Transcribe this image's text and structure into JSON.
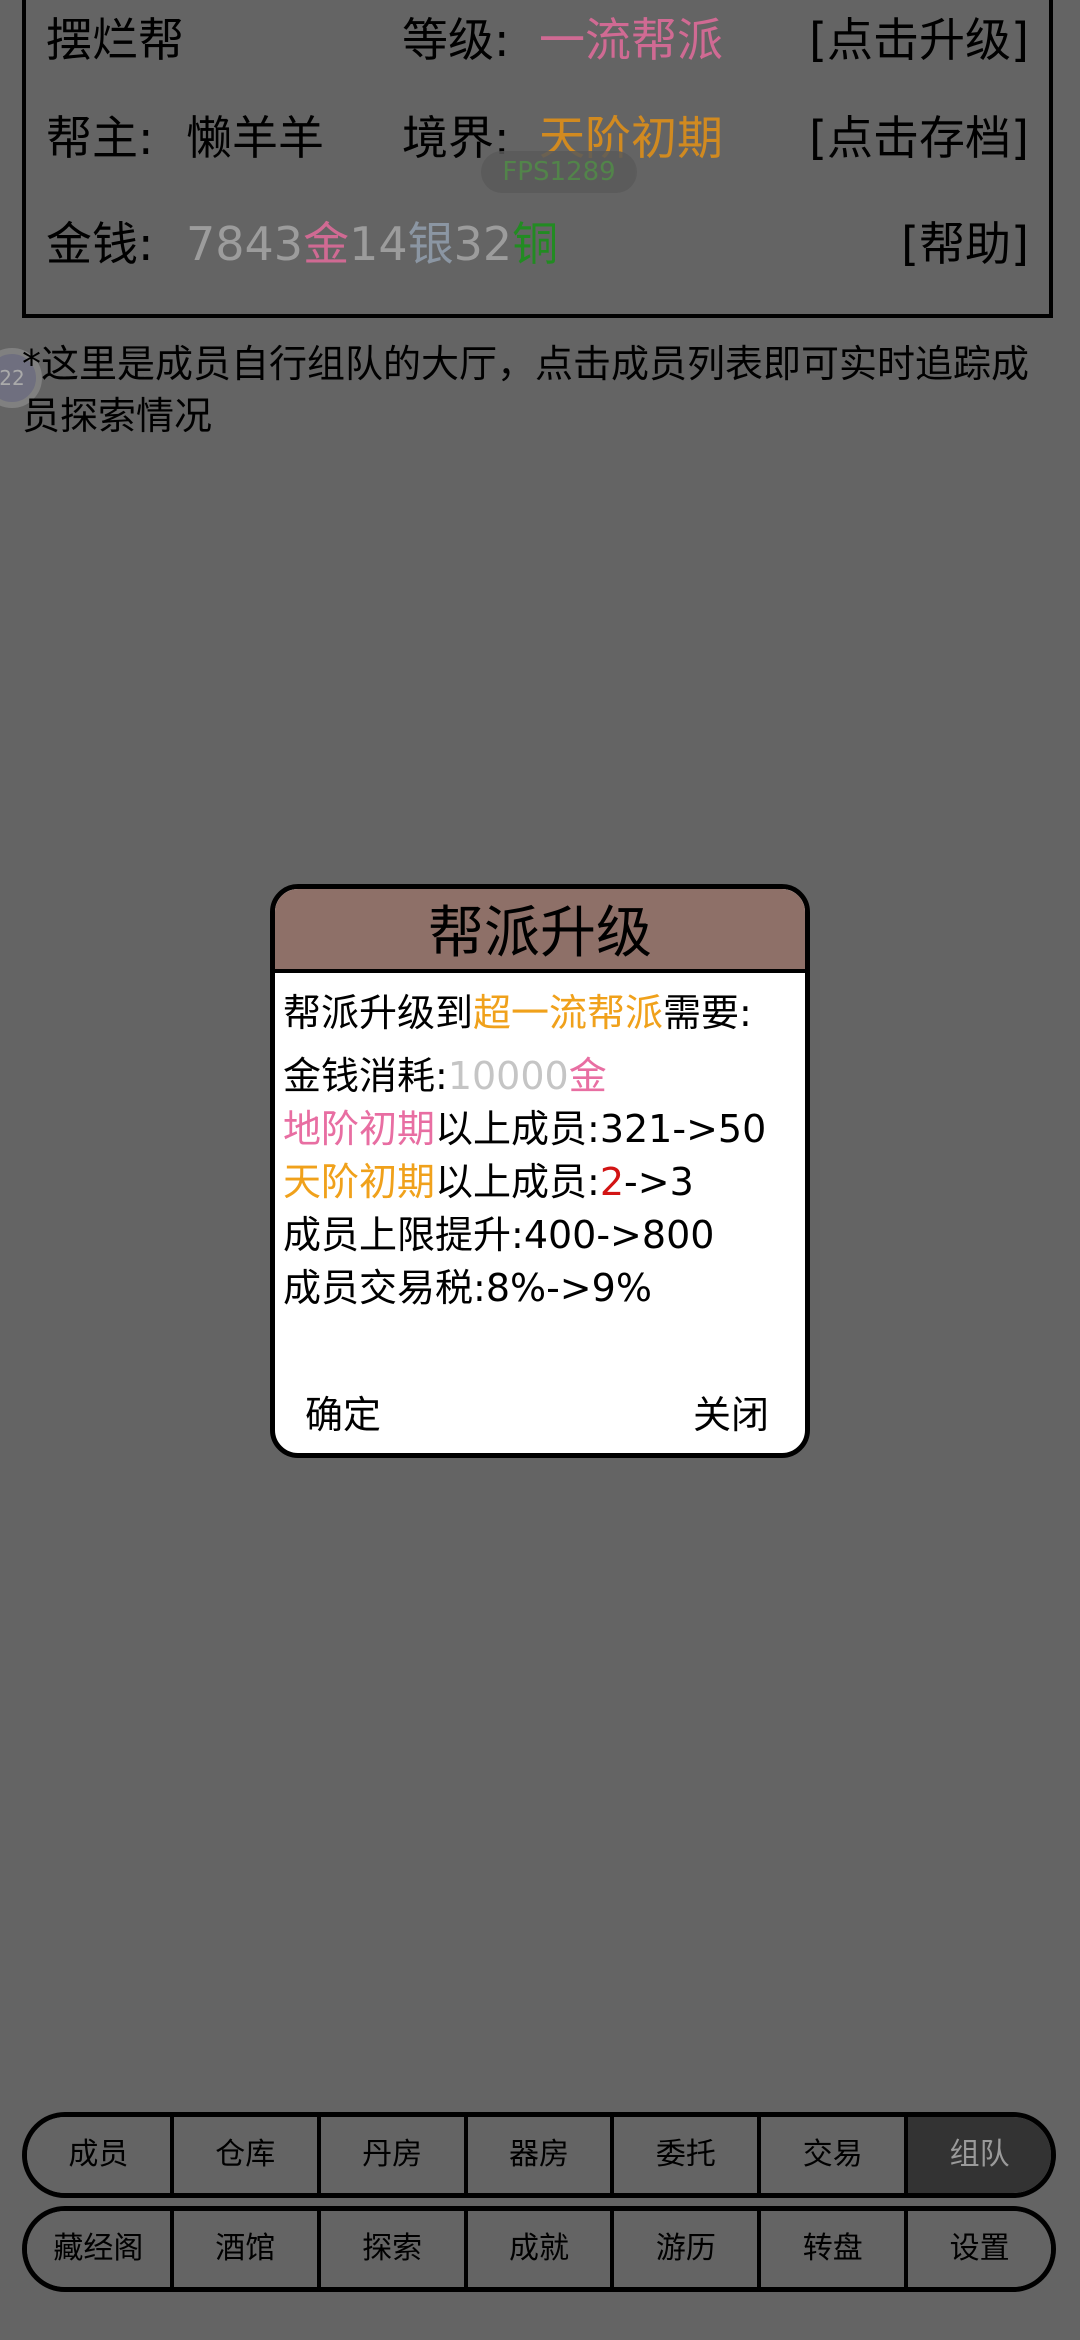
{
  "header": {
    "sect_name": "摆烂帮",
    "level_label": "等级:",
    "level_value": "一流帮派",
    "upgrade_button": "[点击升级]",
    "leader_label": "帮主:",
    "leader_name": "懒羊羊",
    "realm_label": "境界:",
    "realm_value": "天阶初期",
    "save_button": "[点击存档]",
    "money_label": "金钱:",
    "money": {
      "gold": "7843",
      "gold_unit": "金",
      "silver": "14",
      "silver_unit": "银",
      "copper": "32",
      "copper_unit": "铜"
    },
    "help_button": "[帮助]",
    "fps": "FPS1289"
  },
  "notice": "*这里是成员自行组队的大厅，点击成员列表即可实时追踪成员探索情况",
  "float_ball_text": "22",
  "dialog": {
    "title": "帮派升级",
    "line1_prefix": "帮派升级到",
    "target_level": "超一流帮派",
    "line1_suffix": "需要:",
    "cost_label": "金钱消耗:",
    "cost_value": "10000",
    "cost_unit": "金",
    "req1_realm": "地阶初期",
    "req1_text": "以上成员:",
    "req1_value": "321->50",
    "req2_realm": "天阶初期",
    "req2_text": "以上成员:",
    "req2_current": "2",
    "req2_target": "->3",
    "limit_text": "成员上限提升:",
    "limit_value": "400->800",
    "tax_text": "成员交易税:",
    "tax_value": "8%->9%",
    "confirm": "确定",
    "close": "关闭"
  },
  "tabs_row1": [
    "成员",
    "仓库",
    "丹房",
    "器房",
    "委托",
    "交易",
    "组队"
  ],
  "tabs_row2": [
    "藏经阁",
    "酒馆",
    "探索",
    "成就",
    "游历",
    "转盘",
    "设置"
  ],
  "active_tab": "组队"
}
